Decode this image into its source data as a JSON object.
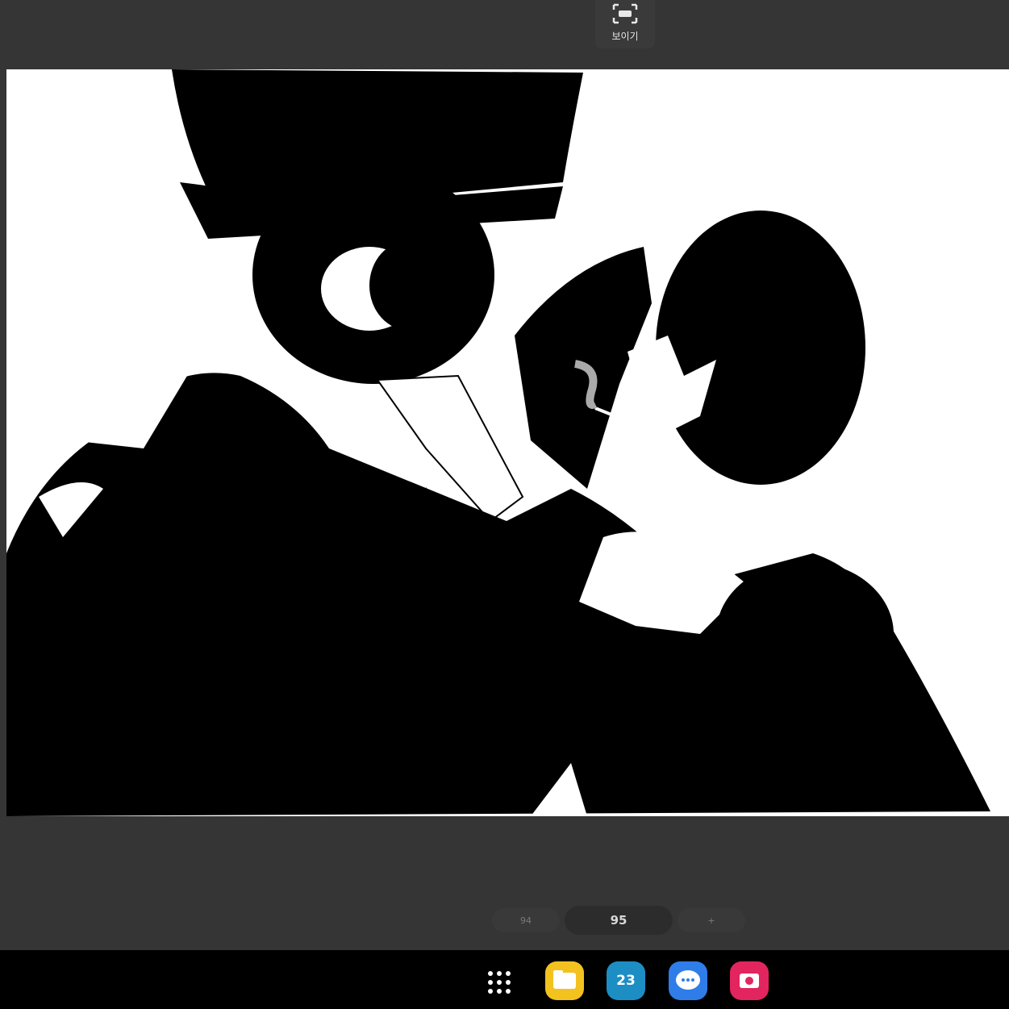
{
  "top_bar": {
    "view_label": "보이기",
    "icon": "fit-screen-icon"
  },
  "timeline": {
    "prev_frame": "94",
    "current_frame": "95",
    "add_label": "+"
  },
  "taskbar": {
    "apps_icon": "apps-grid-icon",
    "files_icon": "folder-icon",
    "calendar_label": "23",
    "messages_icon": "chat-bubble-icon",
    "camera_icon": "camera-icon"
  },
  "colors": {
    "background": "#353535",
    "taskbar": "#000000",
    "canvas": "#ffffff"
  }
}
